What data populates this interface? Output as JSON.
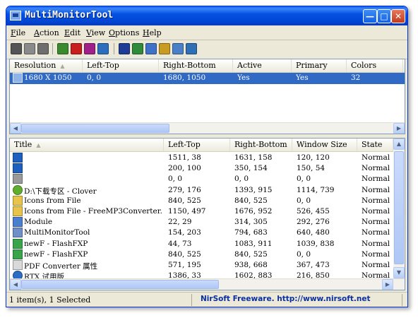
{
  "window": {
    "title": "MultiMonitorTool"
  },
  "menu": [
    {
      "label": "File",
      "u": "F",
      "rest": "ile"
    },
    {
      "label": "Action",
      "u": "A",
      "rest": "ction"
    },
    {
      "label": "Edit",
      "u": "E",
      "rest": "dit"
    },
    {
      "label": "View",
      "u": "V",
      "rest": "iew"
    },
    {
      "label": "Options",
      "u": "O",
      "rest": "ptions"
    },
    {
      "label": "Help",
      "u": "H",
      "rest": "elp"
    }
  ],
  "toolbar": [
    {
      "name": "disable-monitor-icon",
      "color": "#555555"
    },
    {
      "name": "enable-monitor-icon",
      "color": "#8a8a8a"
    },
    {
      "name": "switch-monitor-icon",
      "color": "#6e6e6e"
    },
    {
      "name": "monitor-settings-icon",
      "color": "#3b8a2e"
    },
    {
      "name": "turn-off-icon",
      "color": "#c81e1e"
    },
    {
      "name": "turn-on-icon",
      "color": "#a0208a"
    },
    {
      "name": "move-window-icon",
      "color": "#2a6ebd"
    },
    {
      "name": "save-icon",
      "color": "#1e3c96"
    },
    {
      "name": "refresh-icon",
      "color": "#2f8a3a"
    },
    {
      "name": "copy-icon",
      "color": "#3e72c8"
    },
    {
      "name": "properties-icon",
      "color": "#c89b22"
    },
    {
      "name": "find-icon",
      "color": "#4a80c8"
    },
    {
      "name": "exit-icon",
      "color": "#2f6fb5"
    }
  ],
  "monitors": {
    "columns": [
      "Resolution",
      "Left-Top",
      "Right-Bottom",
      "Active",
      "Primary",
      "Colors"
    ],
    "rows": [
      {
        "resolution": "1680 X 1050",
        "left_top": "0, 0",
        "right_bottom": "1680, 1050",
        "active": "Yes",
        "primary": "Yes",
        "colors": "32",
        "selected": true
      }
    ]
  },
  "windows": {
    "columns": [
      "Title",
      "Left-Top",
      "Right-Bottom",
      "Window Size",
      "State"
    ],
    "rows": [
      {
        "icon": "blue-app-icon",
        "title": "",
        "left_top": "1511, 38",
        "right_bottom": "1631, 158",
        "size": "120, 120",
        "state": "Normal"
      },
      {
        "icon": "blue-app-icon",
        "title": "",
        "left_top": "200, 100",
        "right_bottom": "350, 154",
        "size": "150, 54",
        "state": "Normal"
      },
      {
        "icon": "cursor-icon",
        "title": "",
        "left_top": "0, 0",
        "right_bottom": "0, 0",
        "size": "0, 0",
        "state": "Normal"
      },
      {
        "icon": "clover-icon",
        "title": "D:\\下载专区 - Clover",
        "left_top": "279, 176",
        "right_bottom": "1393, 915",
        "size": "1114, 739",
        "state": "Normal"
      },
      {
        "icon": "folder-icon",
        "title": "Icons from File",
        "left_top": "840, 525",
        "right_bottom": "840, 525",
        "size": "0, 0",
        "state": "Normal"
      },
      {
        "icon": "folder-icon",
        "title": "Icons from File - FreeMP3Converter...",
        "left_top": "1150, 497",
        "right_bottom": "1676, 952",
        "size": "526, 455",
        "state": "Normal"
      },
      {
        "icon": "window-icon",
        "title": "Module",
        "left_top": "22, 29",
        "right_bottom": "314, 305",
        "size": "292, 276",
        "state": "Normal"
      },
      {
        "icon": "monitor-icon",
        "title": "MultiMonitorTool",
        "left_top": "154, 203",
        "right_bottom": "794, 683",
        "size": "640, 480",
        "state": "Normal"
      },
      {
        "icon": "flashfxp-icon",
        "title": "newF - FlashFXP",
        "left_top": "44, 73",
        "right_bottom": "1083, 911",
        "size": "1039, 838",
        "state": "Normal"
      },
      {
        "icon": "flashfxp-icon",
        "title": "newF - FlashFXP",
        "left_top": "840, 525",
        "right_bottom": "840, 525",
        "size": "0, 0",
        "state": "Normal"
      },
      {
        "icon": "document-icon",
        "title": "PDF Converter 属性",
        "left_top": "571, 195",
        "right_bottom": "938, 668",
        "size": "367, 473",
        "state": "Normal"
      },
      {
        "icon": "rtx-icon",
        "title": "RTX 试用版",
        "left_top": "1386, 33",
        "right_bottom": "1602, 883",
        "size": "216, 850",
        "state": "Normal"
      }
    ]
  },
  "status": {
    "selection": "1 item(s), 1 Selected",
    "link": "NirSoft Freeware.  http://www.nirsoft.net"
  }
}
